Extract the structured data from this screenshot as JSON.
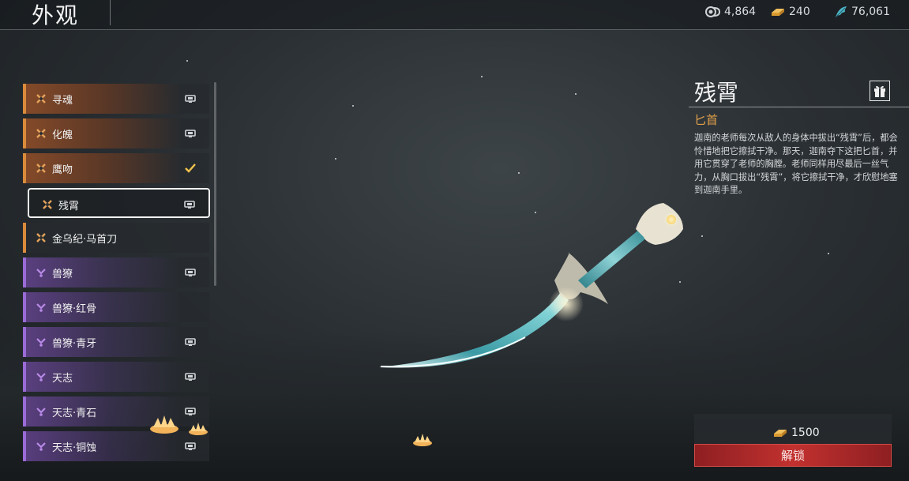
{
  "header": {
    "title": "外观",
    "currencies": [
      {
        "icon": "spiral-coin-icon",
        "value": "4,864"
      },
      {
        "icon": "gold-ingot-icon",
        "value": "240"
      },
      {
        "icon": "jade-feather-icon",
        "value": "76,061"
      }
    ]
  },
  "list": {
    "items": [
      {
        "label": "寻魂",
        "rarity": "orange",
        "status_icon": "preview-icon"
      },
      {
        "label": "化魄",
        "rarity": "orange",
        "status_icon": "preview-icon"
      },
      {
        "label": "鹰吻",
        "rarity": "orange",
        "status_icon": "check-icon"
      },
      {
        "label": "残霄",
        "rarity": "orange",
        "status_icon": "preview-icon",
        "selected": true
      },
      {
        "label": "金乌纪·马首刀",
        "rarity": "orange",
        "status_icon": ""
      },
      {
        "label": "兽獠",
        "rarity": "purple",
        "status_icon": "preview-icon"
      },
      {
        "label": "兽獠·红骨",
        "rarity": "purple",
        "status_icon": ""
      },
      {
        "label": "兽獠·青牙",
        "rarity": "purple",
        "status_icon": "preview-icon"
      },
      {
        "label": "天志",
        "rarity": "purple",
        "status_icon": "preview-icon"
      },
      {
        "label": "天志·青石",
        "rarity": "purple",
        "status_icon": "preview-icon"
      },
      {
        "label": "天志·铜蚀",
        "rarity": "purple",
        "status_icon": "preview-icon"
      }
    ]
  },
  "detail": {
    "name": "残霄",
    "type": "匕首",
    "description": "迦南的老师每次从敌人的身体中拔出“残霄”后，都会怜惜地把它擦拭干净。那天，迦南夺下这把匕首，并用它贯穿了老师的胸膛。老师同样用尽最后一丝气力，从胸口拔出“残霄”，将它擦拭干净，才欣慰地塞到迦南手里。"
  },
  "purchase": {
    "price": "1500",
    "currency_icon": "gold-ingot-icon",
    "unlock_label": "解锁"
  },
  "colors": {
    "orange_rarity": "#d98a3a",
    "purple_rarity": "#9a6bd6",
    "type_label": "#e4a24a",
    "unlock_button": "#c2312f"
  }
}
